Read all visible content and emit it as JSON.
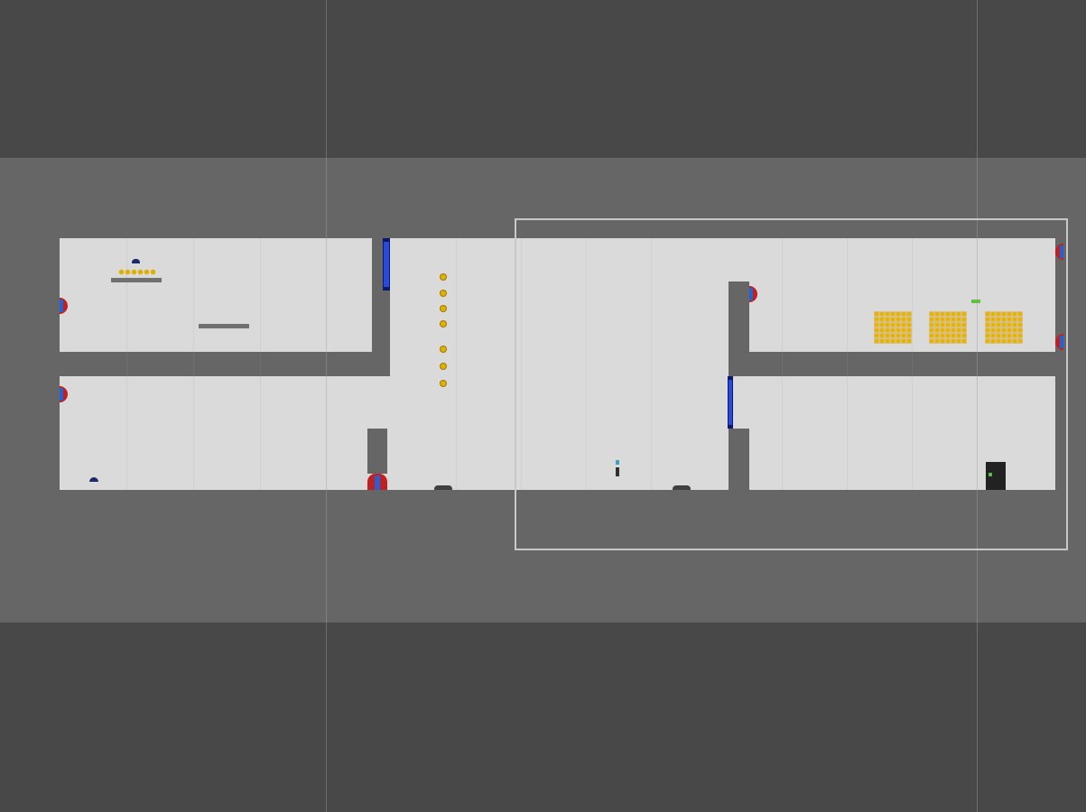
{
  "scene": {
    "background_color": "#484848",
    "level_band_color": "#666666",
    "floor_color": "#dadada",
    "selection_color": "#c8c8c8",
    "coin_color": "#e0b000",
    "portal_colors": [
      "#c02020",
      "#2860d0"
    ],
    "door_color": "#2a4ad8"
  },
  "objects": {
    "portals": [
      "portal-left-upper",
      "portal-left-lower",
      "portal-mid-bottom",
      "portal-right-center",
      "portal-far-right-top",
      "portal-far-right-mid"
    ],
    "coin_column_count": 7,
    "coin_stacks": 3,
    "player_icon": "player-icon",
    "exit_icon": "exit-door-icon"
  }
}
